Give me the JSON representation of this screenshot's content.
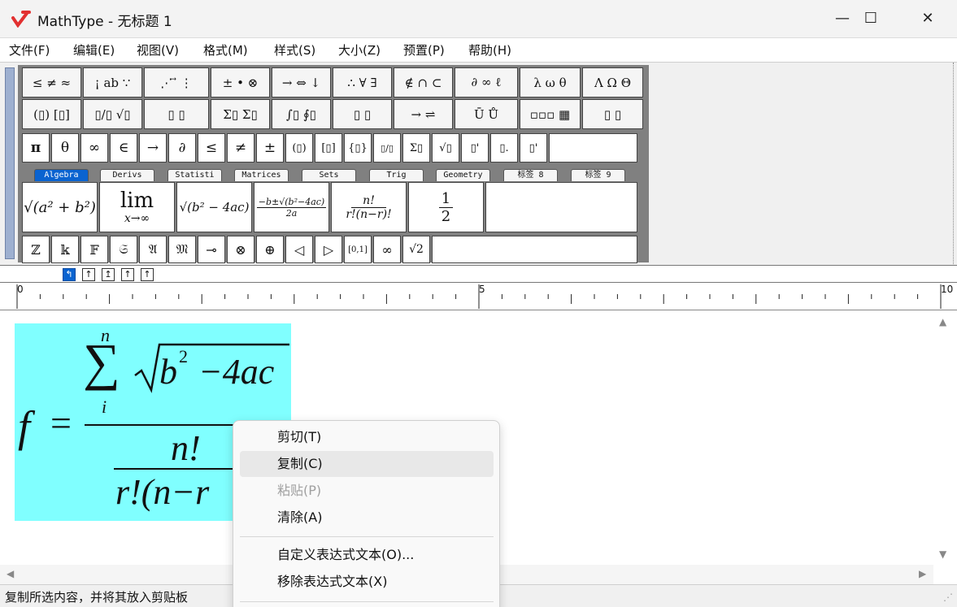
{
  "window": {
    "title": "MathType - 无标题 1",
    "minimize_glyph": "—",
    "maximize_glyph": "☐",
    "close_glyph": "✕"
  },
  "menu": [
    "文件(F)",
    "编辑(E)",
    "视图(V)",
    "格式(M)",
    "样式(S)",
    "大小(Z)",
    "预置(P)",
    "帮助(H)"
  ],
  "palette": {
    "row1": [
      "≤ ≠ ≈",
      "¡ ab ∵",
      "⋰ ⃗ ⋮",
      "± • ⊗",
      "→ ⇔ ↓",
      "∴ ∀ ∃",
      "∉ ∩ ⊂",
      "∂ ∞ ℓ",
      "λ ω θ",
      "Λ Ω Θ"
    ],
    "row2": [
      "(▯) [▯]",
      "▯/▯ √▯",
      "▯ ▯",
      "Σ▯ Σ▯",
      "∫▯ ∮▯",
      "▯ ▯",
      "→ ⇌",
      "Ū Ů",
      "▫▫▫ ▦",
      "▯ ▯"
    ],
    "symbols": [
      "π",
      "θ",
      "∞",
      "∈",
      "→",
      "∂",
      "≤",
      "≠",
      "±",
      "(▯)",
      "[▯]",
      "{▯}",
      "▯/▯",
      "Σ▯",
      "√▯",
      "▯'",
      "▯.",
      "▯'"
    ],
    "tabs": [
      "Algebra",
      "Derivs",
      "Statisti",
      "Matrices",
      "Sets",
      "Trig",
      "Geometry",
      "标签 8",
      "标签 9"
    ],
    "bottom": [
      "ℤ",
      "𝕜",
      "𝔽",
      "𝔖",
      "𝔄",
      "𝔐",
      "⊸",
      "⊗",
      "⊕",
      "◁",
      "▷",
      "[0,1]",
      "∞",
      "√2"
    ]
  },
  "templates": {
    "sqrt_ab": "√(a² + b²)",
    "lim_top": "lim",
    "lim_bottom": "x→∞",
    "disc": "√(b² − 4ac)",
    "quad_num": "−b±√(b²−4ac)",
    "quad_den": "2a",
    "perm_num": "n!",
    "perm_den": "r!(n−r)!",
    "half_num": "1",
    "half_den": "2"
  },
  "nudge": [
    "↰",
    "↑",
    "↥",
    "↑",
    "↑"
  ],
  "ruler": {
    "label0": "0",
    "label5": "5",
    "label10": "10"
  },
  "equation": {
    "lhs": "f",
    "eq": "=",
    "sum_top": "n",
    "sum_bottom": "i",
    "sigma": "∑",
    "radicand": "b",
    "exp": "2",
    "rest": "−4ac",
    "num": "n!",
    "den": "r!(n−r"
  },
  "context_menu": {
    "cut": "剪切(T)",
    "copy": "复制(C)",
    "paste": "粘贴(P)",
    "clear": "清除(A)",
    "custom_text": "自定义表达式文本(O)...",
    "remove_text": "移除表达式文本(X)"
  },
  "status": "复制所选内容，并将其放入剪贴板",
  "colors": {
    "selection": "#80ffff",
    "accent": "#0a63d0",
    "app_icon": "#e23030"
  }
}
